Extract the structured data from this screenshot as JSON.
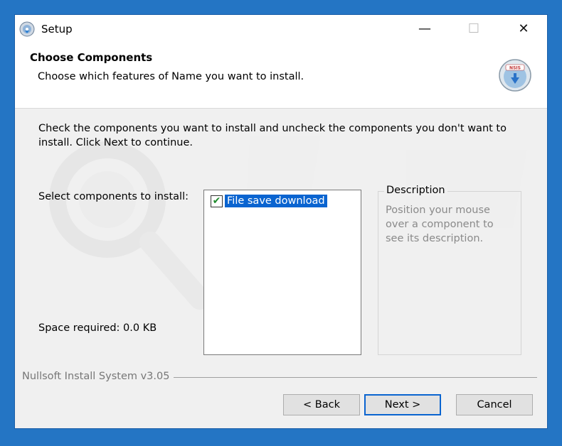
{
  "window": {
    "title": "Setup",
    "controls": {
      "minimize": "—",
      "maximize": "☐",
      "close": "✕"
    }
  },
  "header": {
    "title": "Choose Components",
    "subtitle": "Choose which features of Name you want to install."
  },
  "body": {
    "instructions": "Check the components you want to install and uncheck the components you don't want to install. Click Next to continue.",
    "select_label": "Select components to install:",
    "space_required": "Space required: 0.0 KB"
  },
  "components": [
    {
      "label": "File save download",
      "checked": true,
      "selected": true
    }
  ],
  "description": {
    "legend": "Description",
    "text": "Position your mouse over a component to see its description."
  },
  "footer": {
    "brand": "Nullsoft Install System v3.05"
  },
  "buttons": {
    "back": "< Back",
    "next": "Next >",
    "cancel": "Cancel"
  },
  "icons": {
    "app": "installer-disc-icon",
    "header_logo": "nsis-logo-icon",
    "check": "checkmark-icon"
  },
  "colors": {
    "accent": "#0a64d0",
    "check_green": "#1e8a2c",
    "desktop_blue": "#2475c4"
  }
}
